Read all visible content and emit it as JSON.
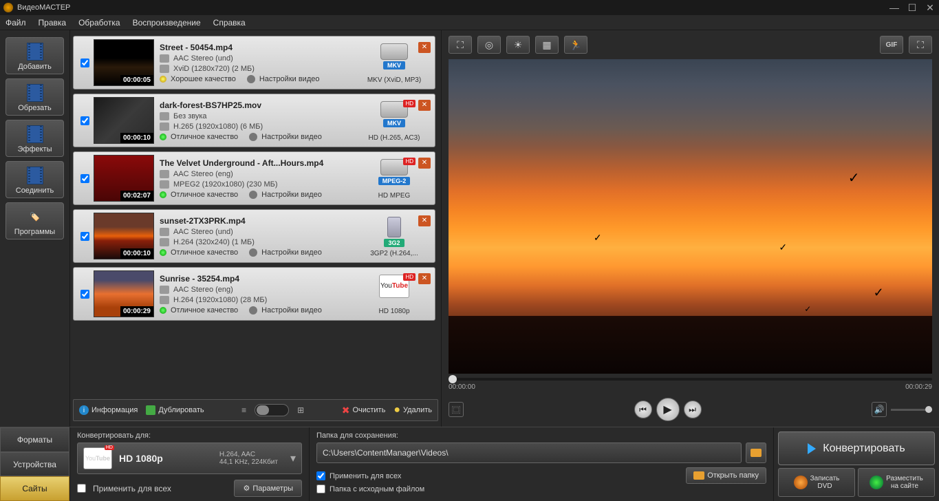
{
  "app_title": "ВидеоМАСТЕР",
  "menu": [
    "Файл",
    "Правка",
    "Обработка",
    "Воспроизведение",
    "Справка"
  ],
  "sidebar": [
    {
      "label": "Добавить"
    },
    {
      "label": "Обрезать"
    },
    {
      "label": "Эффекты"
    },
    {
      "label": "Соединить"
    },
    {
      "label": "Программы"
    }
  ],
  "files": [
    {
      "name": "Street - 50454.mp4",
      "audio": "AAC Stereo (und)",
      "video": "XviD (1280x720) (2 МБ)",
      "duration": "00:00:05",
      "quality": "Хорошее качество",
      "quality_color": "yellow",
      "settings": "Настройки видео",
      "format": "MKV",
      "format_desc": "MKV (XviD, MP3)",
      "hd": false,
      "icon": "cam",
      "thumb": "street"
    },
    {
      "name": "dark-forest-BS7HP25.mov",
      "audio": "Без звука",
      "video": "H.265 (1920x1080) (6 МБ)",
      "duration": "00:00:10",
      "quality": "Отличное качество",
      "quality_color": "green",
      "settings": "Настройки видео",
      "format": "MKV",
      "format_desc": "HD (H.265, AC3)",
      "hd": true,
      "icon": "cam",
      "thumb": "forest"
    },
    {
      "name": "The Velvet Underground - Aft...Hours.mp4",
      "audio": "AAC Stereo (eng)",
      "video": "MPEG2 (1920x1080) (230 МБ)",
      "duration": "00:02:07",
      "quality": "Отличное качество",
      "quality_color": "green",
      "settings": "Настройки видео",
      "format": "MPEG-2",
      "format_desc": "HD MPEG",
      "hd": true,
      "icon": "cam",
      "thumb": "velvet"
    },
    {
      "name": "sunset-2TX3PRK.mp4",
      "audio": "AAC Stereo (und)",
      "video": "H.264 (320x240) (1 МБ)",
      "duration": "00:00:10",
      "quality": "Отличное качество",
      "quality_color": "green",
      "settings": "Настройки видео",
      "format": "3G2",
      "format_desc": "3GP2 (H.264,...",
      "hd": false,
      "icon": "phone",
      "thumb": "sunset-t"
    },
    {
      "name": "Sunrise - 35254.mp4",
      "audio": "AAC Stereo (eng)",
      "video": "H.264 (1920x1080) (28 МБ)",
      "duration": "00:00:29",
      "quality": "Отличное качество",
      "quality_color": "green",
      "settings": "Настройки видео",
      "format": "YouTube",
      "format_desc": "HD 1080p",
      "hd": true,
      "icon": "youtube",
      "thumb": "sunrise-t"
    }
  ],
  "list_toolbar": {
    "info": "Информация",
    "duplicate": "Дублировать",
    "clear": "Очистить",
    "delete": "Удалить"
  },
  "preview_time": {
    "current": "00:00:00",
    "total": "00:00:29"
  },
  "tabs": [
    "Форматы",
    "Устройства",
    "Сайты"
  ],
  "convert_for": {
    "label": "Конвертировать для:",
    "format_name": "HD 1080p",
    "details_l1": "H.264, AAC",
    "details_l2": "44,1 KHz, 224Кбит",
    "apply_all": "Применить для всех",
    "params": "Параметры"
  },
  "save_folder": {
    "label": "Папка для сохранения:",
    "path": "C:\\Users\\ContentManager\\Videos\\",
    "apply_all": "Применить для всех",
    "source_folder": "Папка с исходным файлом",
    "open": "Открыть папку"
  },
  "actions": {
    "convert": "Конвертировать",
    "burn_l1": "Записать",
    "burn_l2": "DVD",
    "publish_l1": "Разместить",
    "publish_l2": "на сайте"
  },
  "hd_text": "HD",
  "yt_you": "You",
  "yt_tube": "Tube"
}
